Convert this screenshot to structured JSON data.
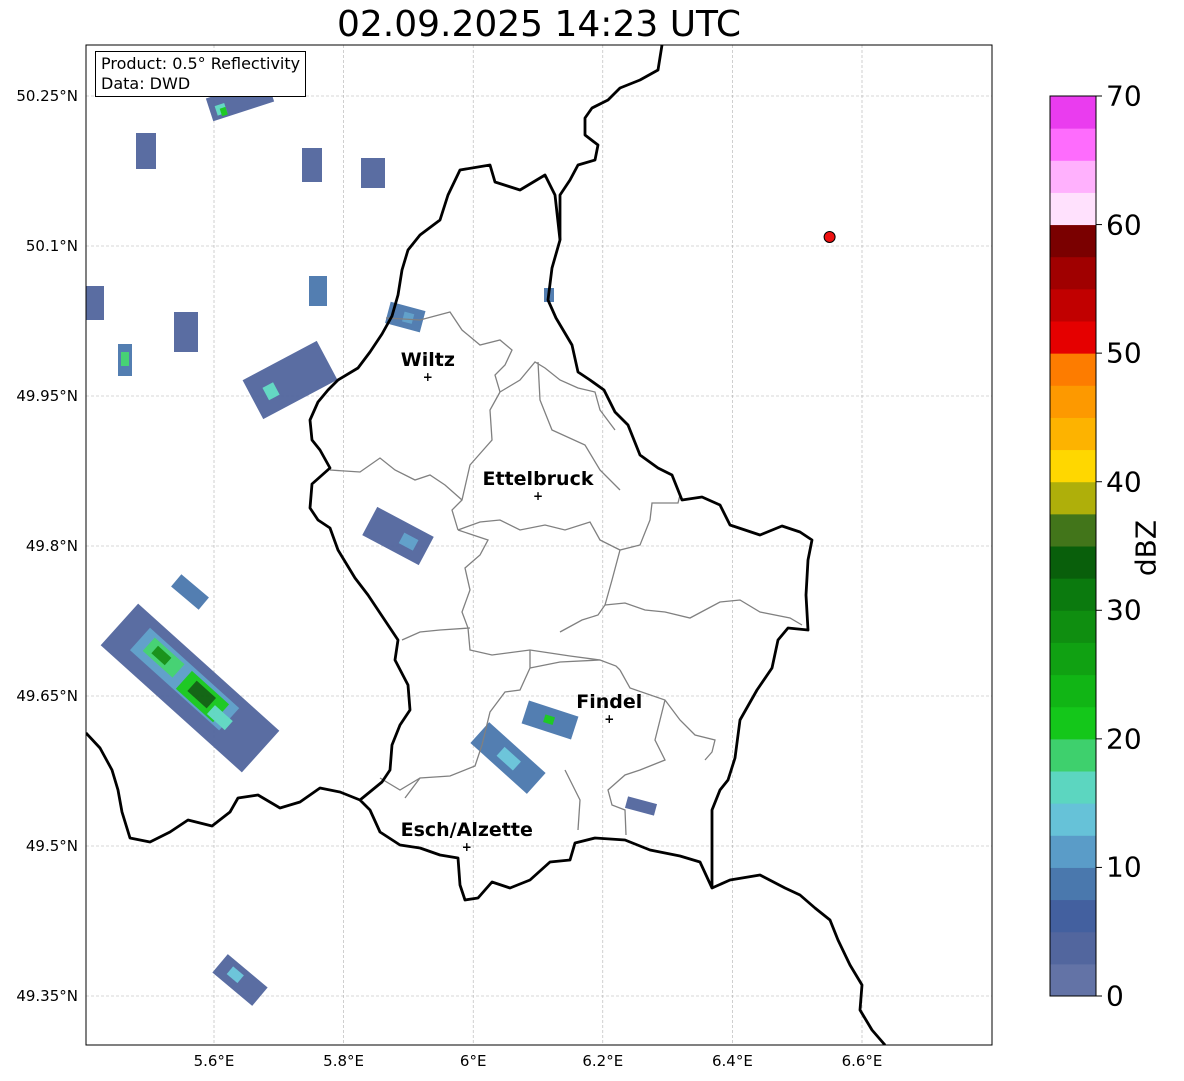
{
  "title": "02.09.2025 14:23 UTC",
  "info": {
    "product": "Product: 0.5° Reflectivity",
    "data": "Data: DWD"
  },
  "lat_labels": [
    "50.25°N",
    "50.1°N",
    "49.95°N",
    "49.8°N",
    "49.65°N",
    "49.5°N",
    "49.35°N"
  ],
  "lon_labels": [
    "5.6°E",
    "5.8°E",
    "6°E",
    "6.2°E",
    "6.4°E",
    "6.6°E"
  ],
  "cities": [
    {
      "name": "Wiltz",
      "lon": 5.93,
      "lat": 49.969
    },
    {
      "name": "Ettelbruck",
      "lon": 6.1,
      "lat": 49.85
    },
    {
      "name": "Findel",
      "lon": 6.21,
      "lat": 49.627
    },
    {
      "name": "Esch/Alzette",
      "lon": 5.99,
      "lat": 49.499
    }
  ],
  "marker": {
    "label": "radar-site-marker",
    "lon": 6.55,
    "lat": 50.109,
    "color": "#ee1111"
  },
  "colorbar": {
    "label": "dBZ",
    "min": 0,
    "max": 70,
    "step": 2.5,
    "tick_labels": [
      "0",
      "10",
      "20",
      "30",
      "40",
      "50",
      "60",
      "70"
    ],
    "colors": [
      "#6373a6",
      "#52669e",
      "#43609f",
      "#4a78ad",
      "#5a9cc8",
      "#66c2d8",
      "#5cd6c0",
      "#3ed06d",
      "#14c71a",
      "#11b515",
      "#10a112",
      "#0f8e10",
      "#0b7a0e",
      "#095f0b",
      "#42751a",
      "#afaf0a",
      "#ffd700",
      "#fdb300",
      "#fd9900",
      "#fd7c00",
      "#e50000",
      "#c10000",
      "#a00000",
      "#7a0000",
      "#ffe1fd",
      "#ffb1fd",
      "#fe6cfd",
      "#ea3cef"
    ]
  }
}
